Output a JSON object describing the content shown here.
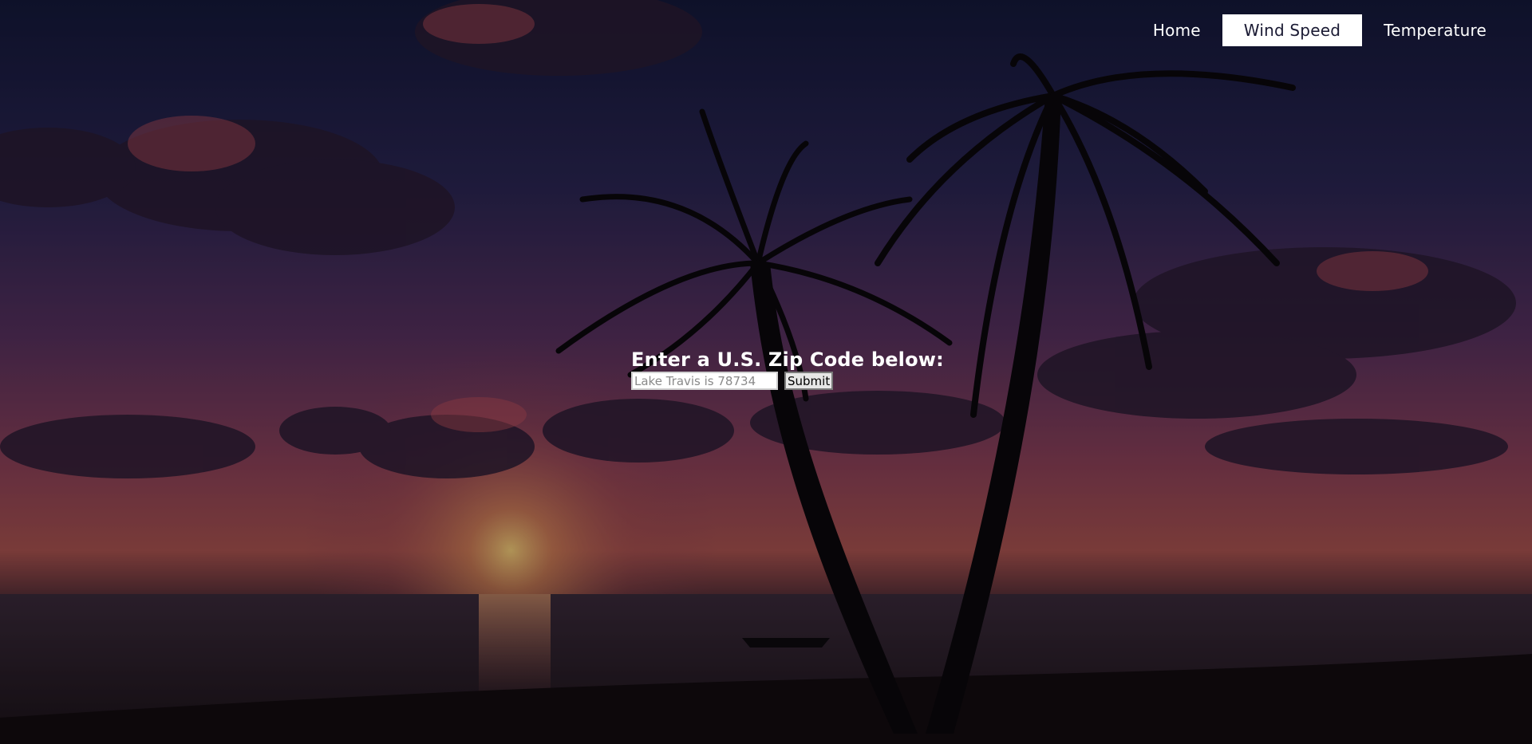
{
  "nav": {
    "items": [
      {
        "label": "Home",
        "active": false
      },
      {
        "label": "Wind Speed",
        "active": true
      },
      {
        "label": "Temperature",
        "active": false
      }
    ]
  },
  "form": {
    "title": "Enter a U.S. Zip Code below:",
    "zip_placeholder": "Lake Travis is 78734",
    "zip_value": "",
    "submit_label": "Submit"
  },
  "background": {
    "description_icon": "sunset-palm-beach-image",
    "colors": {
      "sky_top": "#15193a",
      "sky_mid": "#4a2f5e",
      "horizon": "#c0605a",
      "sun": "#f4c46a",
      "water": "#2a1f2e",
      "silhouette": "#0a070c"
    }
  }
}
